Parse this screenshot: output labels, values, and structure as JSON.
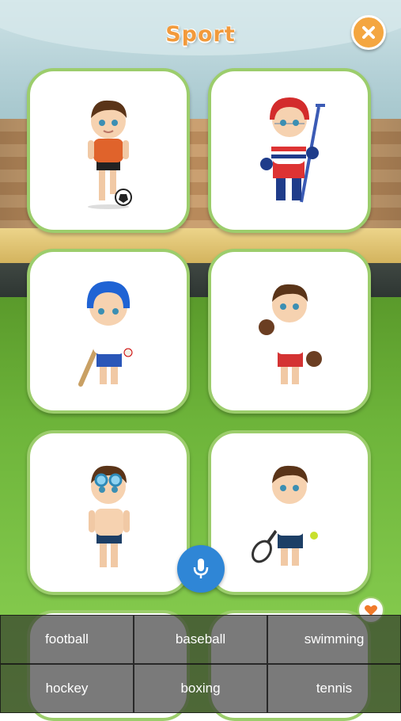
{
  "header": {
    "title": "Sport",
    "close_icon": "close-icon"
  },
  "colors": {
    "title": "#f29a3b",
    "card_border": "#9ccd6c",
    "mic": "#2f86d6",
    "accent": "#f4a640"
  },
  "cards": [
    {
      "figure": "boy-with-soccer-ball"
    },
    {
      "figure": "boy-hockey-player"
    },
    {
      "figure": "boy-baseball-player"
    },
    {
      "figure": "boy-boxer"
    },
    {
      "figure": "boy-swimmer"
    },
    {
      "figure": "boy-tennis-player"
    }
  ],
  "mic_icon": "microphone-icon",
  "answers": [
    "football",
    "baseball",
    "swimming",
    "hockey",
    "boxing",
    "tennis"
  ]
}
